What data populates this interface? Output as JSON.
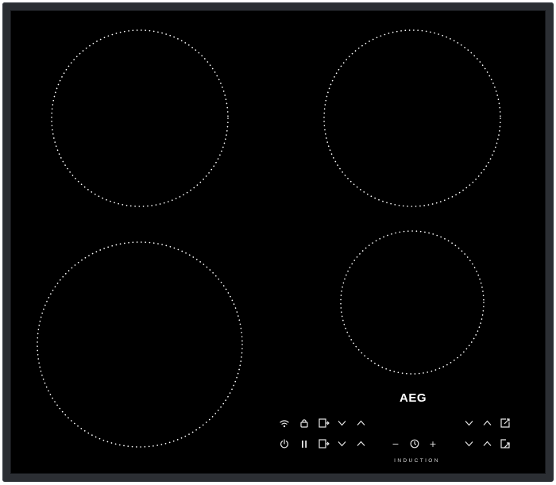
{
  "hob": {
    "brand": "AEG",
    "label": "INDUCTION",
    "colors": {
      "glass": "#000000",
      "frame": "#2b2e33",
      "zone_dots": "#ffffff",
      "controls": "#e6e6e6"
    }
  },
  "cooking_zones": [
    {
      "name": "rear-left"
    },
    {
      "name": "rear-right"
    },
    {
      "name": "front-left"
    },
    {
      "name": "front-right"
    }
  ],
  "controls": {
    "left_row_1": [
      "wifi-hob2hood-icon",
      "child-lock-icon",
      "bridge-zone-icon",
      "down-chevron-icon",
      "up-chevron-icon"
    ],
    "left_row_2": [
      "power-icon",
      "pause-icon",
      "bridge-zone-icon",
      "down-chevron-icon",
      "up-chevron-icon"
    ],
    "timer": {
      "minus": "−",
      "plus": "+",
      "icon": "timer-clock-icon"
    },
    "right_row_1": [
      "down-chevron-icon",
      "up-chevron-icon",
      "zone-select-icon"
    ],
    "right_row_2": [
      "down-chevron-icon",
      "up-chevron-icon",
      "zone-select-icon"
    ]
  }
}
